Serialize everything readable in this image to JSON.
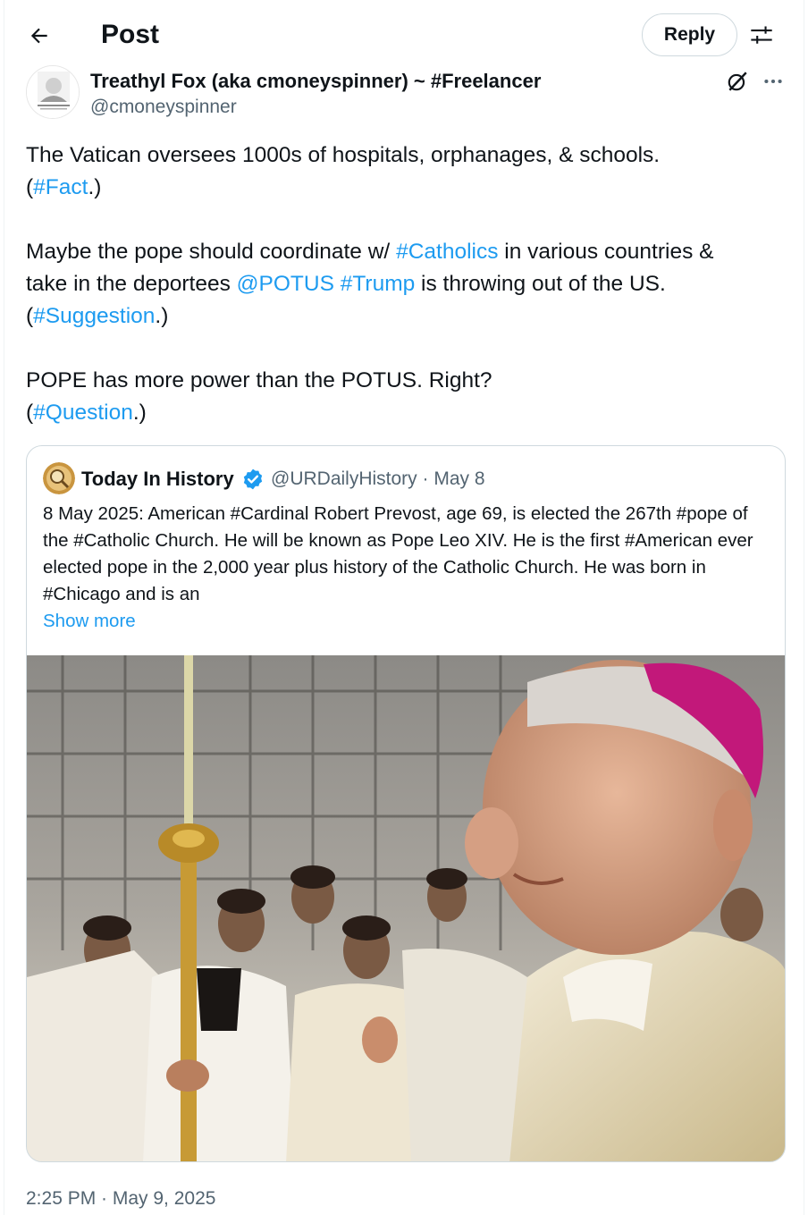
{
  "header": {
    "title": "Post",
    "reply_label": "Reply",
    "back_icon": "arrow-left-icon",
    "settings_icon": "sliders-icon"
  },
  "author": {
    "name": "Treathyl Fox (aka cmoneyspinner) ~ #Freelancer",
    "handle": "@cmoneyspinner"
  },
  "post": {
    "line1": "The Vatican oversees 1000s of hospitals, orphanages, & schools.",
    "tag_fact": "#Fact",
    "line2_before": "Maybe the pope should coordinate w/ ",
    "tag_catholics": "#Catholics",
    "line2_after": " in various countries &",
    "line3_before": "take in the deportees ",
    "mention_potus": "@POTUS",
    "tag_trump": "#Trump",
    "line3_after": " is throwing out of the US.",
    "tag_suggestion": "#Suggestion",
    "line4": "POPE has more power than the POTUS. Right?",
    "tag_question": "#Question",
    "paren_open": "(",
    "paren_close": ".)"
  },
  "quote": {
    "name": "Today In History",
    "handle_date": "@URDailyHistory · May 8",
    "text": "8 May 2025: American #Cardinal Robert Prevost, age 69, is elected the 267th #pope of the #Catholic Church. He will be known as Pope Leo XIV. He is the first #American ever elected pope in the 2,000 year plus history of the Catholic Church. He was born in #Chicago and is an",
    "show_more": "Show more"
  },
  "timestamp": "2:25 PM · May 9, 2025",
  "colors": {
    "link": "#1d9bf0",
    "secondary_text": "#536471",
    "border": "#cfd9de",
    "verified": "#1d9bf0",
    "mozzetta": "#c2187a"
  }
}
